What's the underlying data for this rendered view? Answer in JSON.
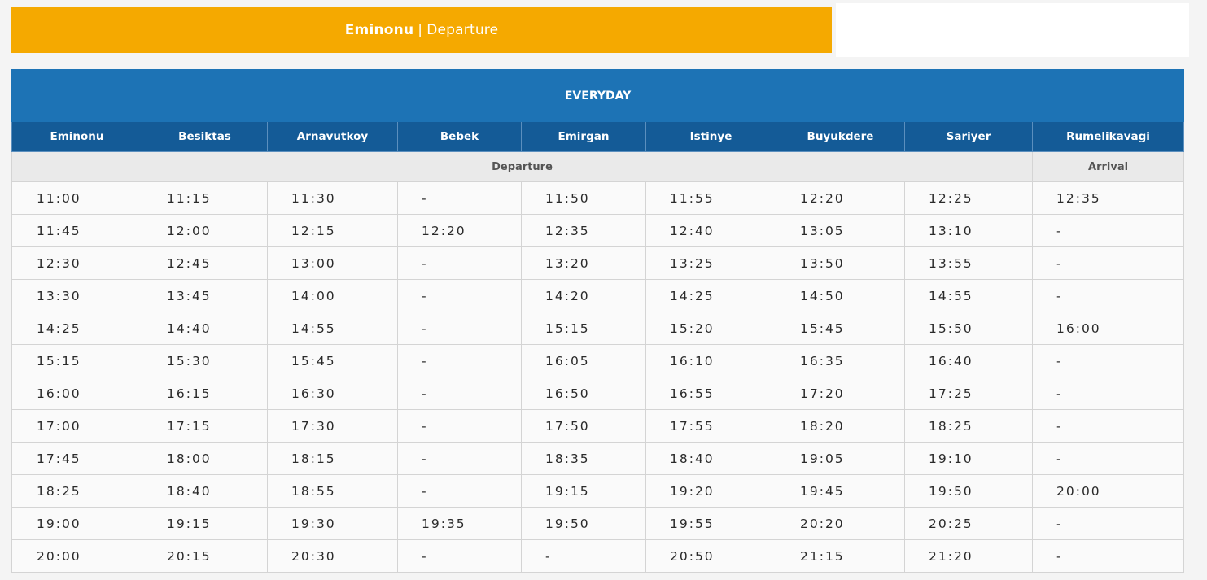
{
  "header": {
    "origin": "Eminonu",
    "separator": "|",
    "direction": "Departure"
  },
  "schedule": {
    "band_label": "EVERYDAY",
    "stations": [
      "Eminonu",
      "Besiktas",
      "Arnavutkoy",
      "Bebek",
      "Emirgan",
      "Istinye",
      "Buyukdere",
      "Sariyer",
      "Rumelikavagi"
    ],
    "departure_label": "Departure",
    "arrival_label": "Arrival",
    "rows": [
      [
        "11:00",
        "11:15",
        "11:30",
        "-",
        "11:50",
        "11:55",
        "12:20",
        "12:25",
        "12:35"
      ],
      [
        "11:45",
        "12:00",
        "12:15",
        "12:20",
        "12:35",
        "12:40",
        "13:05",
        "13:10",
        "-"
      ],
      [
        "12:30",
        "12:45",
        "13:00",
        "-",
        "13:20",
        "13:25",
        "13:50",
        "13:55",
        "-"
      ],
      [
        "13:30",
        "13:45",
        "14:00",
        "-",
        "14:20",
        "14:25",
        "14:50",
        "14:55",
        "-"
      ],
      [
        "14:25",
        "14:40",
        "14:55",
        "-",
        "15:15",
        "15:20",
        "15:45",
        "15:50",
        "16:00"
      ],
      [
        "15:15",
        "15:30",
        "15:45",
        "-",
        "16:05",
        "16:10",
        "16:35",
        "16:40",
        "-"
      ],
      [
        "16:00",
        "16:15",
        "16:30",
        "-",
        "16:50",
        "16:55",
        "17:20",
        "17:25",
        "-"
      ],
      [
        "17:00",
        "17:15",
        "17:30",
        "-",
        "17:50",
        "17:55",
        "18:20",
        "18:25",
        "-"
      ],
      [
        "17:45",
        "18:00",
        "18:15",
        "-",
        "18:35",
        "18:40",
        "19:05",
        "19:10",
        "-"
      ],
      [
        "18:25",
        "18:40",
        "18:55",
        "-",
        "19:15",
        "19:20",
        "19:45",
        "19:50",
        "20:00"
      ],
      [
        "19:00",
        "19:15",
        "19:30",
        "19:35",
        "19:50",
        "19:55",
        "20:20",
        "20:25",
        "-"
      ],
      [
        "20:00",
        "20:15",
        "20:30",
        "-",
        "-",
        "20:50",
        "21:15",
        "21:20",
        "-"
      ]
    ]
  },
  "colors": {
    "banner": "#f5a900",
    "band": "#1d73b5",
    "station_header": "#145b97",
    "phase_row": "#eaeaea"
  }
}
